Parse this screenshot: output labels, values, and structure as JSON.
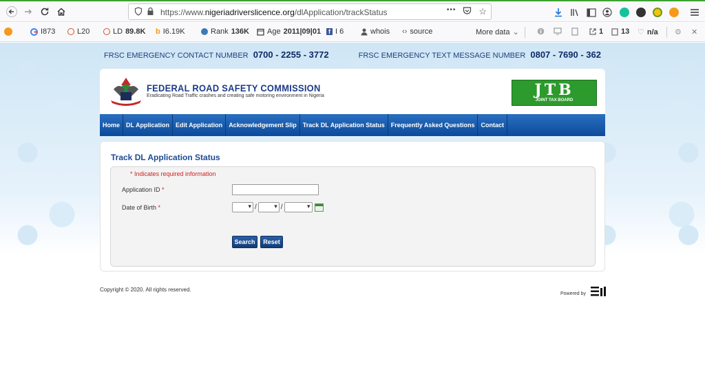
{
  "browser": {
    "url_prefix": "https://www.",
    "url_host": "nigeriadriverslicence.org",
    "url_path": "/dlApplication/trackStatus",
    "more_glyph": "•••"
  },
  "extensions": {
    "google": "I873",
    "l": "L20",
    "ld": "LD",
    "ld_value": "89.8K",
    "i": "I6.19K",
    "rank_label": "Rank",
    "rank_value": "136K",
    "age_label": "Age",
    "age_value": "2011|09|01",
    "fb": "I 6",
    "whois": "whois",
    "source": "source",
    "more_data": "More data",
    "links": "1",
    "pages": "13",
    "na": "n/a"
  },
  "site": {
    "emergency_contact_label": "FRSC EMERGENCY CONTACT NUMBER",
    "emergency_contact_number": "0700 - 2255 - 3772",
    "emergency_text_label": "FRSC EMERGENCY TEXT MESSAGE NUMBER",
    "emergency_text_number": "0807 - 7690 - 362",
    "org_name": "FEDERAL ROAD SAFETY COMMISSION",
    "org_tagline": "Eradicating Road Traffic crashes and creating safe motoring environment in Nigeria",
    "jtb_big": "JTB",
    "jtb_small": "JOINT TAX BOARD"
  },
  "menu": {
    "items": [
      "Home",
      "DL Application",
      "Edit Application",
      "Acknowledgement Slip",
      "Track DL Application Status",
      "Frequently Asked Questions",
      "Contact"
    ]
  },
  "form": {
    "title": "Track DL Application Status",
    "required_note": "* Indicates required information",
    "application_id_label": "Application ID",
    "dob_label": "Date of Birth",
    "required_star": "*",
    "search_label": "Search",
    "reset_label": "Reset"
  },
  "footer": {
    "copyright": "Copyright © 2020. All rights reserved.",
    "powered_by": "Powered by"
  },
  "colors": {
    "menu_blue": "#0c4a9a",
    "title_blue": "#1c4b93",
    "required_red": "#cc2222",
    "jtb_green": "#2d9a2d"
  }
}
